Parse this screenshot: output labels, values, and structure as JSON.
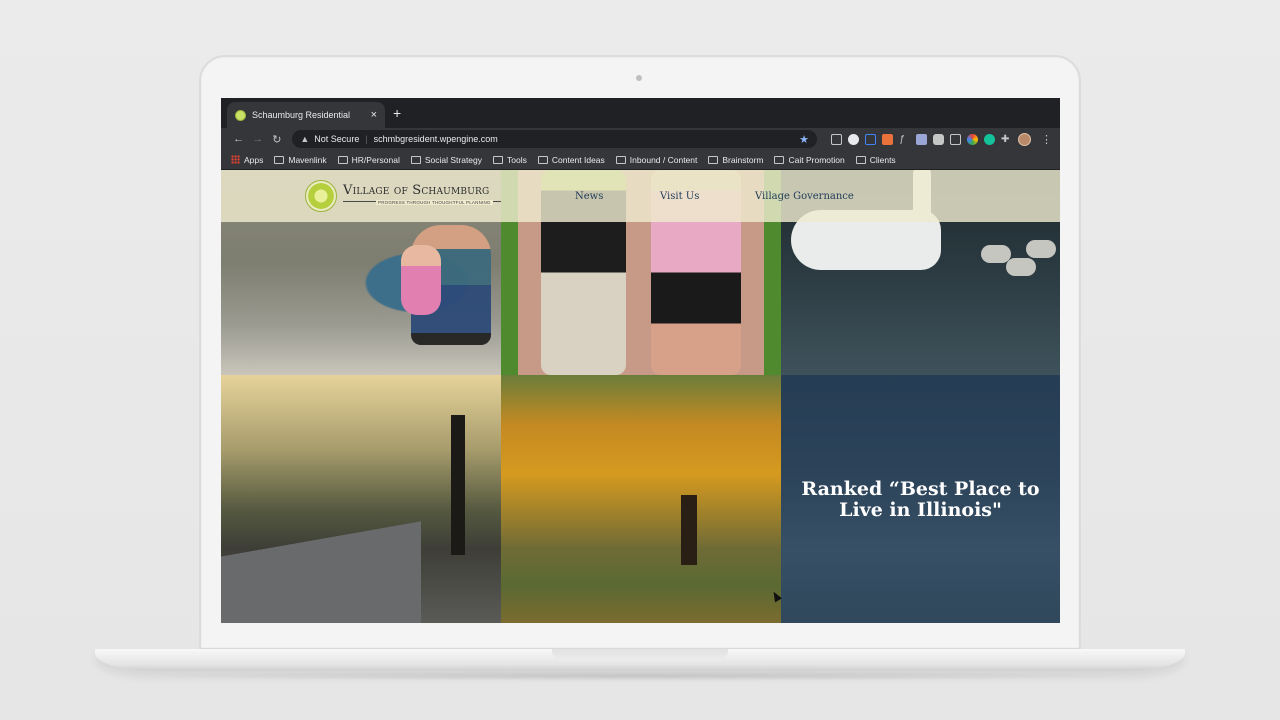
{
  "browser": {
    "tab": {
      "title": "Schaumburg Residential",
      "close": "×"
    },
    "new_tab": "+",
    "toolbar": {
      "back": "←",
      "forward": "→",
      "reload": "↻",
      "security": "Not Secure",
      "separator": "|",
      "url": "schmbgresident.wpengine.com",
      "bookmark_star": "★",
      "menu": "⋮"
    },
    "bookmarks": [
      {
        "label": "Apps",
        "icon": "apps-grid-icon"
      },
      {
        "label": "Mavenlink",
        "icon": "folder-icon"
      },
      {
        "label": "HR/Personal",
        "icon": "folder-icon"
      },
      {
        "label": "Social Strategy",
        "icon": "folder-icon"
      },
      {
        "label": "Tools",
        "icon": "folder-icon"
      },
      {
        "label": "Content Ideas",
        "icon": "folder-icon"
      },
      {
        "label": "Inbound / Content",
        "icon": "folder-icon"
      },
      {
        "label": "Brainstorm",
        "icon": "folder-icon"
      },
      {
        "label": "Cait Promotion",
        "icon": "folder-icon"
      },
      {
        "label": "Clients",
        "icon": "folder-icon"
      }
    ]
  },
  "site": {
    "logo": {
      "name": "Village of Schaumburg",
      "tagline": "PROGRESS THROUGH THOUGHTFUL PLANNING"
    },
    "nav": [
      {
        "label": "News"
      },
      {
        "label": "Visit Us"
      },
      {
        "label": "Village Governance"
      }
    ],
    "feature_tile": {
      "headline": "Ranked “Best Place to Live in Illinois\""
    }
  },
  "colors": {
    "header_bg": "#eeeace",
    "nav_text": "#1f3b57",
    "chrome_dark": "#202124",
    "chrome_mid": "#35363a"
  }
}
